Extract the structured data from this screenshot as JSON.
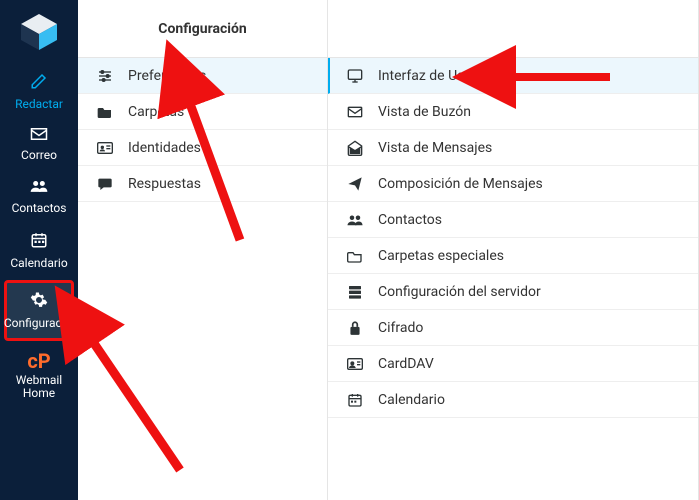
{
  "colors": {
    "sidebar_bg": "#0b1f3a",
    "accent": "#00acee",
    "highlight": "#e11",
    "selected_bg": "#ecf7fd"
  },
  "sidebar": {
    "items": [
      {
        "label": "Redactar",
        "icon": "compose-icon"
      },
      {
        "label": "Correo",
        "icon": "mail-icon"
      },
      {
        "label": "Contactos",
        "icon": "contacts-icon"
      },
      {
        "label": "Calendario",
        "icon": "calendar-icon"
      },
      {
        "label": "Configuraci...",
        "icon": "gear-icon"
      },
      {
        "label": "Webmail Home",
        "icon": "cpanel-icon"
      }
    ]
  },
  "config_column": {
    "title": "Configuración",
    "items": [
      {
        "label": "Preferencias",
        "icon": "sliders-icon",
        "selected": true
      },
      {
        "label": "Carpetas",
        "icon": "folder-icon"
      },
      {
        "label": "Identidades",
        "icon": "id-card-icon"
      },
      {
        "label": "Respuestas",
        "icon": "chat-icon"
      }
    ]
  },
  "pref_column": {
    "items": [
      {
        "label": "Interfaz de Usuario",
        "icon": "monitor-icon",
        "selected": true
      },
      {
        "label": "Vista de Buzón",
        "icon": "envelope-icon"
      },
      {
        "label": "Vista de Mensajes",
        "icon": "envelope-open-icon"
      },
      {
        "label": "Composición de Mensajes",
        "icon": "paper-plane-icon"
      },
      {
        "label": "Contactos",
        "icon": "contacts-icon"
      },
      {
        "label": "Carpetas especiales",
        "icon": "folder-outline-icon"
      },
      {
        "label": "Configuración del servidor",
        "icon": "server-icon"
      },
      {
        "label": "Cifrado",
        "icon": "lock-icon"
      },
      {
        "label": "CardDAV",
        "icon": "address-card-icon"
      },
      {
        "label": "Calendario",
        "icon": "calendar-icon"
      }
    ]
  }
}
